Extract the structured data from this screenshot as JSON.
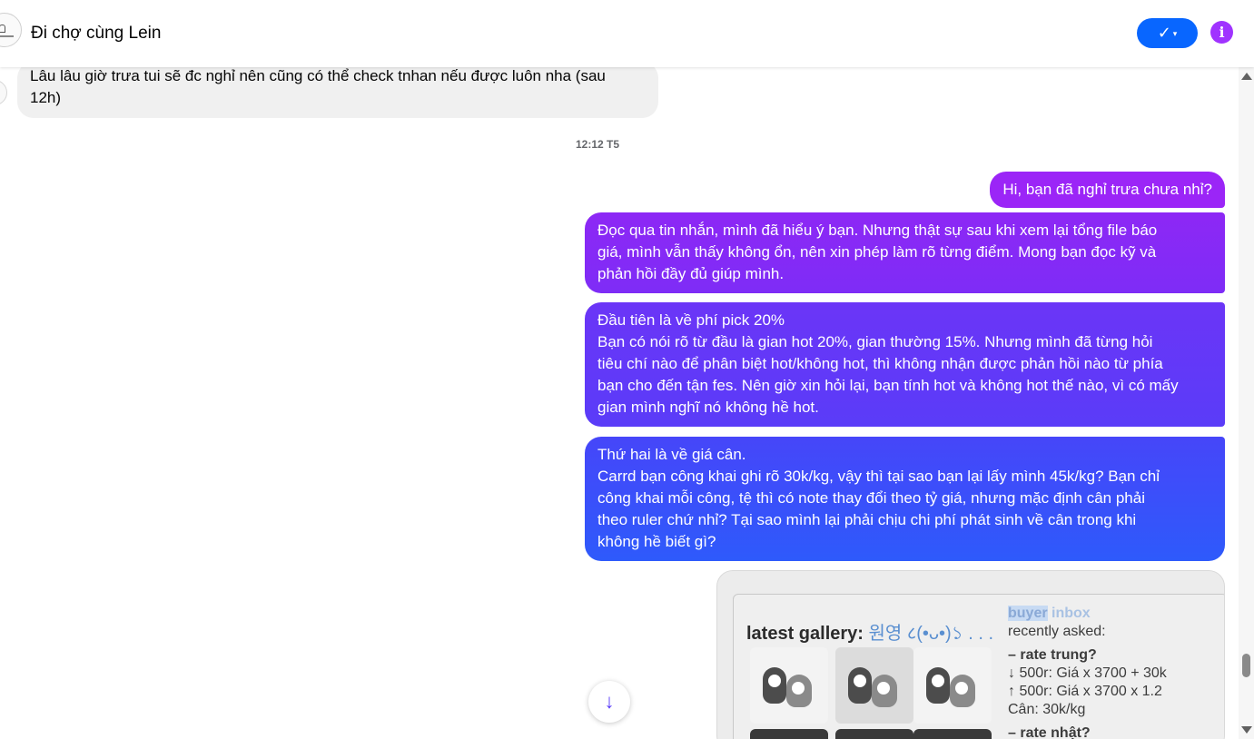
{
  "header": {
    "title": "Đi chợ cùng Lein",
    "check_icon": "✓",
    "check_caret": "▾",
    "info_icon": "i"
  },
  "colors": {
    "accent_blue": "#0866ff",
    "info_purple": "#a033ff",
    "bubble_incoming": "#f0f0f0",
    "bubble_out_top": "#9b25f7",
    "bubble_out_bottom": "#2e5afb"
  },
  "messages": {
    "incoming": {
      "line1": "Lâu lâu giờ trưa tui sẽ đc nghỉ nên cũng có thể check tnhan nếu được luôn nha (sau",
      "line2": "12h)"
    },
    "timestamp": "12:12 T5",
    "outgoing": [
      {
        "lines": [
          "Hi, bạn đã nghỉ trưa chưa nhỉ?"
        ]
      },
      {
        "lines": [
          "Đọc qua tin nhắn, mình đã hiểu ý bạn. Nhưng thật sự sau khi xem lại tổng file báo",
          "giá, mình vẫn thấy không ổn, nên xin phép làm rõ từng điểm. Mong bạn đọc kỹ và",
          "phản hồi đầy đủ giúp mình."
        ]
      },
      {
        "lines": [
          "Đầu tiên là về phí pick 20%",
          "Bạn có nói rõ từ đầu là gian hot 20%, gian thường 15%. Nhưng mình đã từng hỏi",
          "tiêu chí nào để phân biệt hot/không hot, thì không nhận được phản hồi nào từ phía",
          "bạn cho đến tận fes. Nên giờ xin hỏi lại, bạn tính hot và không hot thế nào, vì có mấy",
          "gian mình nghĩ nó không hề hot."
        ]
      },
      {
        "lines": [
          "Thứ hai là về giá cân.",
          "Carrd bạn công khai ghi rõ 30k/kg, vậy thì tại sao bạn lại lấy mình 45k/kg? Bạn chỉ",
          "công khai mỗi công, tệ thì có note thay đổi theo tỷ giá, nhưng mặc định cân phải",
          "theo ruler chứ nhỉ? Tại sao mình lại phải chịu chi phí phát sinh về cân trong khi",
          "không hề biết gì?"
        ]
      }
    ],
    "image": {
      "gallery_title": "latest gallery:",
      "gallery_sub": "원영 ८(•ᴗ•)১ . . .",
      "inbox_label_hl": "buyer",
      "inbox_label": " inbox",
      "recent": "recently asked:",
      "q1": "– rate trung?",
      "a1": "↓ 500r: Giá x 3700 + 30k",
      "a2": "↑ 500r: Giá x 3700 x 1.2",
      "a3": "Cân: 30k/kg",
      "q2": "– rate nhật?"
    }
  },
  "scroll_down_icon": "↓"
}
